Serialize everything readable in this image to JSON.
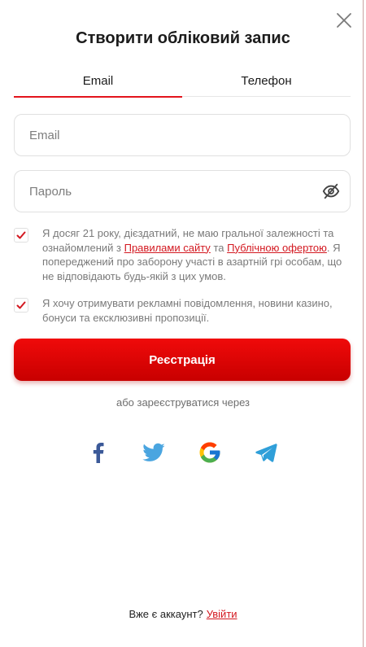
{
  "modal": {
    "title": "Створити обліковий запис",
    "close_icon": "close-icon"
  },
  "tabs": [
    {
      "label": "Email",
      "active": true
    },
    {
      "label": "Телефон",
      "active": false
    }
  ],
  "form": {
    "email": {
      "placeholder": "Email",
      "value": ""
    },
    "password": {
      "placeholder": "Пароль",
      "value": "",
      "toggle_icon": "eye-off-icon"
    }
  },
  "consents": {
    "terms": {
      "checked": true,
      "text_before": "Я досяг 21 року, дієздатний, не маю гральної залежності та ознайомлений з",
      "link1": "Правилами сайту",
      "text_middle": "та",
      "link2": "Публічною офертою",
      "text_after": ". Я попереджений про заборону участі в азартній грі особам, що не відповідають будь-якій з цих умов."
    },
    "ads": {
      "checked": true,
      "text": "Я хочу отримувати рекламні повідомлення, новини казино, бонуси та ексклюзивні пропозиції."
    }
  },
  "register_button": {
    "label": "Реєстрація",
    "color": "#e50000"
  },
  "alt_signup": {
    "text": "або зареєструватися через",
    "providers": [
      {
        "icon": "facebook-icon",
        "color": "#3b5998"
      },
      {
        "icon": "twitter-icon",
        "color": "#4aa5e0"
      },
      {
        "icon": "google-icon",
        "color": "#4285f4"
      },
      {
        "icon": "telegram-icon",
        "color": "#2f9fd9"
      }
    ]
  },
  "footer": {
    "text": "Вже є аккаунт?",
    "link": "Увійти"
  },
  "colors": {
    "accent": "#e3141c",
    "link": "#d31820"
  }
}
